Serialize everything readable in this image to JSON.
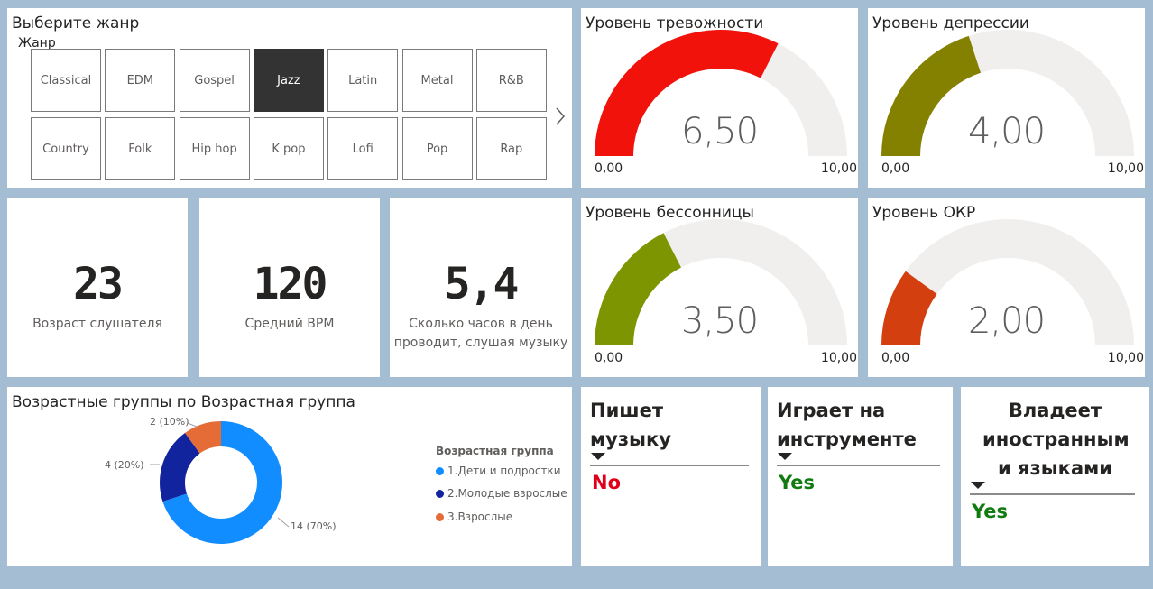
{
  "genre_slicer": {
    "title": "Выберите жанр",
    "subtitle": "Жанр",
    "selected": "Jazz",
    "row1": [
      "Classical",
      "EDM",
      "Gospel",
      "Jazz",
      "Latin",
      "Metal",
      "R&B"
    ],
    "row2": [
      "Country",
      "Folk",
      "Hip hop",
      "K pop",
      "Lofi",
      "Pop",
      "Rap"
    ],
    "next_icon": "chevron-right-icon"
  },
  "gauges": {
    "anxiety": {
      "title": "Уровень тревожности",
      "value": 6.5,
      "display": "6,50",
      "min": "0,00",
      "max": "10,00",
      "color": "#f0120b"
    },
    "depression": {
      "title": "Уровень депрессии",
      "value": 4.0,
      "display": "4,00",
      "min": "0,00",
      "max": "10,00",
      "color": "#858100"
    },
    "insomnia": {
      "title": "Уровень бессонницы",
      "value": 3.5,
      "display": "3,50",
      "min": "0,00",
      "max": "10,00",
      "color": "#7c9500"
    },
    "ocd": {
      "title": "Уровень ОКР",
      "value": 2.0,
      "display": "2,00",
      "min": "0,00",
      "max": "10,00",
      "color": "#d43f10"
    }
  },
  "gauge_track_color": "#f0efee",
  "cards": {
    "age": {
      "value": "23",
      "label": "Возраст слушателя"
    },
    "bpm": {
      "value": "120",
      "label": "Средний BPM"
    },
    "hours": {
      "value": "5,4",
      "label": "Сколько часов в день проводит, слушая музыку"
    }
  },
  "age_chart": {
    "title": "Возрастные группы по Возрастная группа",
    "legend_title": "Возрастная группа",
    "slice_labels": [
      "14 (70%)",
      "4 (20%)",
      "2 (10%)"
    ]
  },
  "chart_data": {
    "type": "pie",
    "categories": [
      "1.Дети и подростки",
      "2.Молодые взрослые",
      "3.Взрослые"
    ],
    "values": [
      14,
      4,
      2
    ],
    "percent": [
      70,
      20,
      10
    ],
    "colors": [
      "#118dff",
      "#12239e",
      "#e66c37"
    ],
    "title": "Возрастные группы по Возрастная группа",
    "legend_title": "Возрастная группа",
    "legend_position": "right",
    "donut": true
  },
  "answers": {
    "writes_music": {
      "title": "Пишет музыку",
      "value": "No",
      "color": "#e0001a"
    },
    "plays_instrument": {
      "title": "Играет на инструменте",
      "value": "Yes",
      "color": "#107c10"
    },
    "foreign_languages": {
      "title": "Владеет иностранным и языками",
      "value": "Yes",
      "color": "#107c10"
    }
  }
}
